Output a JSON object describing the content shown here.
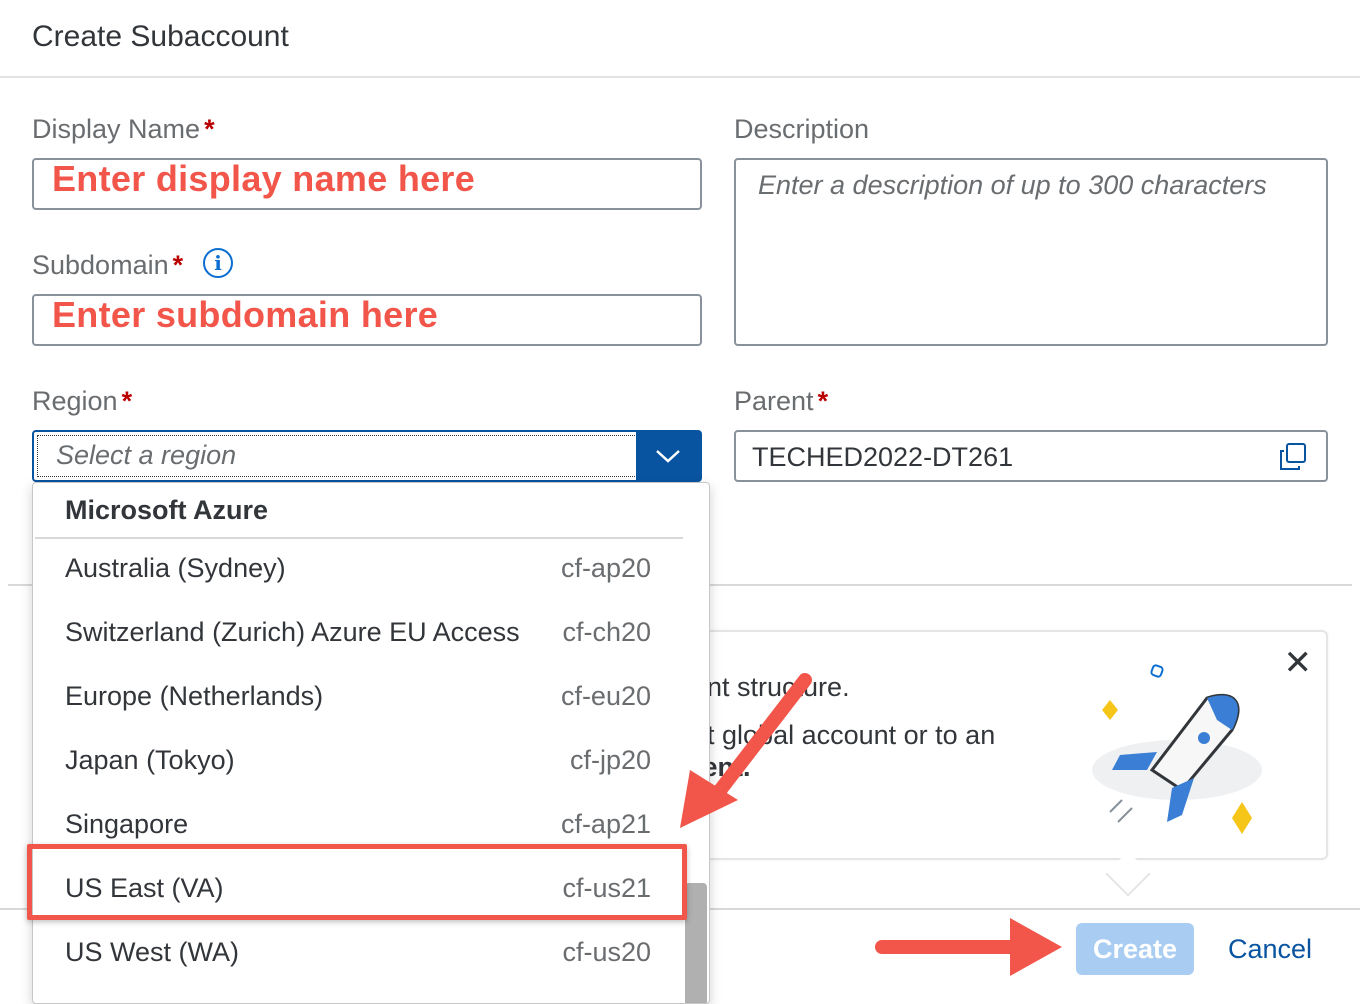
{
  "header": {
    "title": "Create Subaccount"
  },
  "form": {
    "display_name": {
      "label": "Display Name",
      "required": "*",
      "annotation": "Enter display name here"
    },
    "description": {
      "label": "Description",
      "placeholder": "Enter a description of up to 300 characters"
    },
    "subdomain": {
      "label": "Subdomain",
      "required": "*",
      "info_icon": "info-icon",
      "annotation": "Enter subdomain here"
    },
    "region": {
      "label": "Region",
      "required": "*",
      "placeholder": "Select a region"
    },
    "parent": {
      "label": "Parent",
      "required": "*",
      "value": "TECHED2022-DT261",
      "icon": "copy-icon"
    }
  },
  "dropdown": {
    "group": "Microsoft Azure",
    "options": [
      {
        "name": "Australia (Sydney)",
        "code": "cf-ap20"
      },
      {
        "name": "Switzerland (Zurich) Azure EU Access",
        "code": "cf-ch20"
      },
      {
        "name": "Europe (Netherlands)",
        "code": "cf-eu20"
      },
      {
        "name": "Japan (Tokyo)",
        "code": "cf-jp20"
      },
      {
        "name": "Singapore",
        "code": "cf-ap21"
      },
      {
        "name": "US East (VA)",
        "code": "cf-us21"
      },
      {
        "name": "US West (WA)",
        "code": "cf-us20"
      }
    ]
  },
  "info_panel": {
    "line1": "unt structure.",
    "line2": "ot global account or to an",
    "line3": "rent."
  },
  "footer": {
    "create_label": "Create",
    "cancel_label": "Cancel"
  },
  "colors": {
    "primary": "#0854a0",
    "annotation": "#f2554a",
    "required": "#bb0000"
  }
}
